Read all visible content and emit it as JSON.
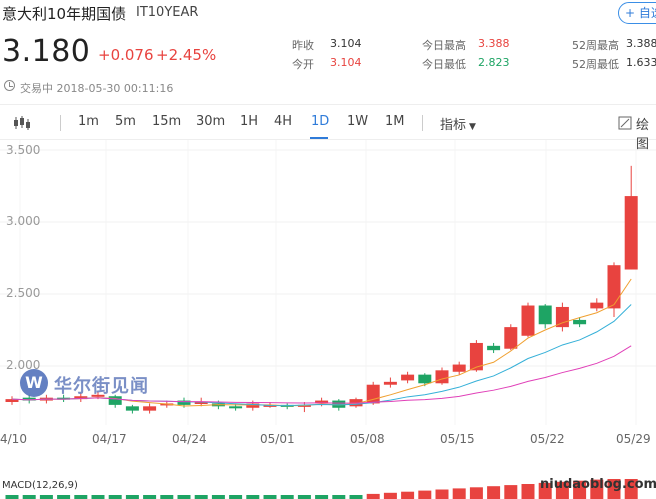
{
  "header": {
    "title": "意大利10年期国债",
    "code": "IT10YEAR",
    "follow_label": "+ 自选"
  },
  "quote": {
    "price": "3.180",
    "change": "+0.076",
    "change_pct": "+2.45%",
    "status": "交易中 2018-05-30 00:11:16"
  },
  "stats": {
    "prev_close_label": "昨收",
    "prev_close": "3.104",
    "open_label": "今开",
    "open": "3.104",
    "day_high_label": "今日最高",
    "day_high": "3.388",
    "day_low_label": "今日最低",
    "day_low": "2.823",
    "wk52_high_label": "52周最高",
    "wk52_high": "3.388",
    "wk52_low_label": "52周最低",
    "wk52_low": "1.633"
  },
  "toolbar": {
    "periods": [
      "1m",
      "5m",
      "15m",
      "30m",
      "1H",
      "4H",
      "1D",
      "1W",
      "1M"
    ],
    "active_period": "1D",
    "indicator_label": "指标",
    "draw_label": "绘图"
  },
  "colors": {
    "up": "#e8433f",
    "down": "#1ea464",
    "accent": "#2f7bd9",
    "ma1": "#f0a030",
    "ma2": "#35b0d8",
    "ma3": "#e040b8"
  },
  "watermark": {
    "brand": "华尔街见闻",
    "site": "niudaoblog.com"
  },
  "chart_data": {
    "type": "candlestick",
    "y_tick_labels": [
      "3.500",
      "3.000",
      "2.500",
      "2.000"
    ],
    "x_tick_labels": [
      "4/10",
      "04/17",
      "04/24",
      "05/01",
      "05/08",
      "05/15",
      "05/22",
      "05/29"
    ],
    "ylim": [
      1.4,
      3.5
    ],
    "candles": [
      {
        "o": 1.75,
        "c": 1.77,
        "h": 1.79,
        "l": 1.73
      },
      {
        "o": 1.78,
        "c": 1.76,
        "h": 1.8,
        "l": 1.74
      },
      {
        "o": 1.76,
        "c": 1.78,
        "h": 1.8,
        "l": 1.74
      },
      {
        "o": 1.78,
        "c": 1.77,
        "h": 1.8,
        "l": 1.75
      },
      {
        "o": 1.77,
        "c": 1.79,
        "h": 1.81,
        "l": 1.75
      },
      {
        "o": 1.79,
        "c": 1.8,
        "h": 1.82,
        "l": 1.77
      },
      {
        "o": 1.79,
        "c": 1.73,
        "h": 1.8,
        "l": 1.71
      },
      {
        "o": 1.72,
        "c": 1.69,
        "h": 1.73,
        "l": 1.67
      },
      {
        "o": 1.69,
        "c": 1.72,
        "h": 1.74,
        "l": 1.67
      },
      {
        "o": 1.73,
        "c": 1.74,
        "h": 1.76,
        "l": 1.71
      },
      {
        "o": 1.76,
        "c": 1.73,
        "h": 1.78,
        "l": 1.71
      },
      {
        "o": 1.74,
        "c": 1.75,
        "h": 1.78,
        "l": 1.72
      },
      {
        "o": 1.74,
        "c": 1.72,
        "h": 1.76,
        "l": 1.7
      },
      {
        "o": 1.72,
        "c": 1.71,
        "h": 1.74,
        "l": 1.69
      },
      {
        "o": 1.71,
        "c": 1.74,
        "h": 1.76,
        "l": 1.69
      },
      {
        "o": 1.73,
        "c": 1.73,
        "h": 1.75,
        "l": 1.71
      },
      {
        "o": 1.73,
        "c": 1.72,
        "h": 1.74,
        "l": 1.7
      },
      {
        "o": 1.72,
        "c": 1.73,
        "h": 1.75,
        "l": 1.68
      },
      {
        "o": 1.74,
        "c": 1.76,
        "h": 1.78,
        "l": 1.72
      },
      {
        "o": 1.76,
        "c": 1.71,
        "h": 1.77,
        "l": 1.69
      },
      {
        "o": 1.72,
        "c": 1.77,
        "h": 1.78,
        "l": 1.71
      },
      {
        "o": 1.74,
        "c": 1.87,
        "h": 1.89,
        "l": 1.73
      },
      {
        "o": 1.87,
        "c": 1.89,
        "h": 1.92,
        "l": 1.85
      },
      {
        "o": 1.9,
        "c": 1.94,
        "h": 1.96,
        "l": 1.88
      },
      {
        "o": 1.94,
        "c": 1.88,
        "h": 1.95,
        "l": 1.86
      },
      {
        "o": 1.88,
        "c": 1.97,
        "h": 1.99,
        "l": 1.87
      },
      {
        "o": 1.96,
        "c": 2.01,
        "h": 2.03,
        "l": 1.94
      },
      {
        "o": 1.97,
        "c": 2.16,
        "h": 2.18,
        "l": 1.96
      },
      {
        "o": 2.14,
        "c": 2.11,
        "h": 2.16,
        "l": 2.09
      },
      {
        "o": 2.12,
        "c": 2.27,
        "h": 2.29,
        "l": 2.11
      },
      {
        "o": 2.21,
        "c": 2.42,
        "h": 2.44,
        "l": 2.2
      },
      {
        "o": 2.42,
        "c": 2.29,
        "h": 2.43,
        "l": 2.26
      },
      {
        "o": 2.27,
        "c": 2.41,
        "h": 2.44,
        "l": 2.24
      },
      {
        "o": 2.32,
        "c": 2.29,
        "h": 2.34,
        "l": 2.27
      },
      {
        "o": 2.4,
        "c": 2.44,
        "h": 2.47,
        "l": 2.38
      },
      {
        "o": 2.4,
        "c": 2.7,
        "h": 2.72,
        "l": 2.34
      },
      {
        "o": 2.67,
        "c": 3.18,
        "h": 3.39,
        "l": 2.67
      }
    ]
  }
}
